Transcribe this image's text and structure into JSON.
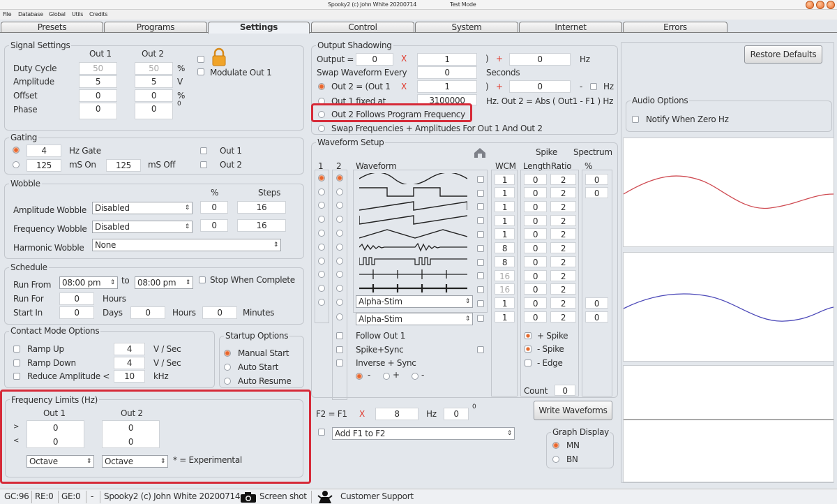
{
  "window": {
    "title": "Spooky2 (c) John White 20200714",
    "mode": "Test Mode"
  },
  "menu": [
    "File",
    "Database",
    "Global",
    "Utils",
    "Credits"
  ],
  "tabs": [
    "Presets",
    "Programs",
    "Settings",
    "Control",
    "System",
    "Internet",
    "Errors"
  ],
  "active_tab": "Settings",
  "signal": {
    "title": "Signal Settings",
    "out1": "Out 1",
    "out2": "Out 2",
    "rows": [
      {
        "label": "Duty Cycle",
        "v1": "50",
        "v2": "50",
        "unit": "%"
      },
      {
        "label": "Amplitude",
        "v1": "5",
        "v2": "5",
        "unit": "V"
      },
      {
        "label": "Offset",
        "v1": "0",
        "v2": "0",
        "unit": "%"
      },
      {
        "label": "Phase",
        "v1": "0",
        "v2": "0",
        "unit": "0"
      }
    ],
    "modulate": "Modulate Out 1"
  },
  "gating": {
    "title": "Gating",
    "hz": "4",
    "hz_label": "Hz Gate",
    "on": "125",
    "on_label": "mS On",
    "off": "125",
    "off_label": "mS Off",
    "out1": "Out 1",
    "out2": "Out 2"
  },
  "wobble": {
    "title": "Wobble",
    "pct": "%",
    "steps": "Steps",
    "amp": {
      "label": "Amplitude Wobble",
      "value": "Disabled",
      "pct": "0",
      "steps": "16"
    },
    "freq": {
      "label": "Frequency Wobble",
      "value": "Disabled",
      "pct": "0",
      "steps": "16"
    },
    "harm": {
      "label": "Harmonic Wobble",
      "value": "None"
    }
  },
  "schedule": {
    "title": "Schedule",
    "run_from": "Run From",
    "from": "08:00 pm",
    "to_label": "to",
    "to": "08:00 pm",
    "stop": "Stop When Complete",
    "run_for": "Run For",
    "run_for_val": "0",
    "hours": "Hours",
    "start_in": "Start In",
    "si_days": "0",
    "days": "Days",
    "si_hours": "0",
    "hours2": "Hours",
    "si_min": "0",
    "minutes": "Minutes"
  },
  "contact": {
    "title": "Contact Mode Options",
    "ramp_up": "Ramp Up",
    "ramp_up_val": "4",
    "ramp_down": "Ramp Down",
    "ramp_down_val": "4",
    "reduce": "Reduce Amplitude <",
    "reduce_val": "10",
    "vsec": "V / Sec",
    "vsec2": "V / Sec",
    "khz": "kHz"
  },
  "startup": {
    "title": "Startup Options",
    "manual": "Manual Start",
    "auto": "Auto Start",
    "resume": "Auto Resume"
  },
  "freqlimits": {
    "title": "Frequency Limits (Hz)",
    "out1": "Out 1",
    "out2": "Out 2",
    "gt": ">",
    "lt": "<",
    "v1a": "0",
    "v1b": "0",
    "v2a": "0",
    "v2b": "0",
    "sel1": "Octave",
    "sel2": "Octave",
    "note": "* = Experimental"
  },
  "shadow": {
    "title": "Output Shadowing",
    "output": "Output =",
    "o_a": "0",
    "x": "X",
    "o_b": "1",
    "paren": ")",
    "plus": "+",
    "o_c": "0",
    "hz": "Hz",
    "swap": "Swap Waveform Every",
    "swap_val": "0",
    "seconds": "Seconds",
    "out2eq": "Out 2 = (Out 1",
    "o2_b": "1",
    "o2_c": "0",
    "minus": "-",
    "fixed": "Out 1 fixed at",
    "fixed_val": "3100000",
    "abs": "Hz. Out 2 = Abs ( Out1 - F1 ) Hz",
    "follows": "Out 2 Follows Program Frequency",
    "swapfa": "Swap Frequencies + Amplitudes For Out 1 And Out 2"
  },
  "waveform": {
    "title": "Waveform Setup",
    "c1": "1",
    "c2": "2",
    "wave": "Waveform",
    "wcm": "WCM",
    "spike": "Spike",
    "length": "Length",
    "ratio": "Ratio",
    "spectrum": "Spectrum",
    "pct": "%",
    "rows": [
      {
        "w": "1",
        "l": "0",
        "r": "2",
        "s": "0"
      },
      {
        "w": "1",
        "l": "0",
        "r": "2",
        "s": "0"
      },
      {
        "w": "1",
        "l": "0",
        "r": "2",
        "s": ""
      },
      {
        "w": "1",
        "l": "0",
        "r": "2",
        "s": ""
      },
      {
        "w": "1",
        "l": "0",
        "r": "2",
        "s": ""
      },
      {
        "w": "8",
        "l": "0",
        "r": "2",
        "s": ""
      },
      {
        "w": "8",
        "l": "0",
        "r": "2",
        "s": ""
      },
      {
        "w": "16",
        "l": "0",
        "r": "2",
        "s": ""
      },
      {
        "w": "16",
        "l": "0",
        "r": "2",
        "s": ""
      },
      {
        "w": "1",
        "l": "0",
        "r": "2",
        "s": "0"
      },
      {
        "w": "1",
        "l": "0",
        "r": "2",
        "s": "0"
      }
    ],
    "alpha1": "Alpha-Stim",
    "alpha2": "Alpha-Stim",
    "follow": "Follow Out 1",
    "spikesync": "Spike+Sync",
    "invsync": "Inverse + Sync",
    "minus": "-",
    "plus": "+",
    "dash": "-",
    "pspike": "+ Spike",
    "mspike": "- Spike",
    "edge": "- Edge",
    "count": "Count",
    "count_val": "0"
  },
  "f2": {
    "label": "F2 = F1",
    "x": "X",
    "val": "8",
    "hz": "Hz",
    "val2": "0",
    "deg": "0",
    "add": "Add F1 to F2"
  },
  "write": "Write Waveforms",
  "graph_display": {
    "title": "Graph Display",
    "mn": "MN",
    "bn": "BN"
  },
  "restore": "Restore Defaults",
  "audio": {
    "title": "Audio Options",
    "notify": "Notify When Zero Hz"
  },
  "status": {
    "gc": "GC:96",
    "re": "RE:0",
    "ge": "GE:0",
    "dash": "-",
    "app": "Spooky2 (c) John White 20200714",
    "screenshot": "Screen shot",
    "support": "Customer Support"
  },
  "colors": {
    "accent": "#e8652c",
    "highlight": "#d62a38",
    "wave_red": "#cf4b52",
    "wave_blue": "#4b48b8"
  }
}
